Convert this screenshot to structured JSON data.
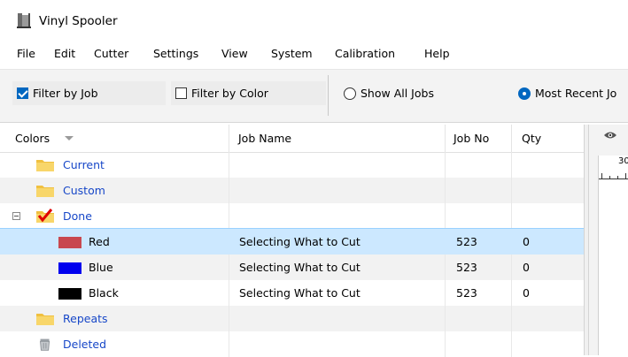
{
  "window": {
    "title": "Vinyl Spooler",
    "icon": "vinyl-spooler-app-icon"
  },
  "menu": [
    "File",
    "Edit",
    "Cutter",
    "Settings",
    "View",
    "System",
    "Calibration",
    "Help"
  ],
  "toolbar": {
    "filter_by_job": {
      "label": "Filter by Job",
      "checked": true
    },
    "filter_by_color": {
      "label": "Filter by Color",
      "checked": false
    },
    "show_all_jobs": {
      "label": "Show All Jobs",
      "selected": false
    },
    "most_recent_jobs": {
      "label": "Most Recent Jo",
      "selected": true
    }
  },
  "columns": {
    "colors": "Colors",
    "job_name": "Job Name",
    "job_no": "Job No",
    "qty": "Qty"
  },
  "rows": [
    {
      "kind": "folder",
      "label": "Current",
      "icon": "folder-icon"
    },
    {
      "kind": "folder",
      "label": "Custom",
      "icon": "folder-icon"
    },
    {
      "kind": "folder",
      "label": "Done",
      "icon": "done-folder-check-icon",
      "expanded": true
    },
    {
      "kind": "item",
      "label": "Red",
      "swatch": "#c8484f",
      "job_name": "Selecting What to Cut",
      "job_no": "523",
      "qty": "0",
      "selected": true
    },
    {
      "kind": "item",
      "label": "Blue",
      "swatch": "#0000ee",
      "job_name": "Selecting What to Cut",
      "job_no": "523",
      "qty": "0"
    },
    {
      "kind": "item",
      "label": "Black",
      "swatch": "#000000",
      "job_name": "Selecting What to Cut",
      "job_no": "523",
      "qty": "0"
    },
    {
      "kind": "folder",
      "label": "Repeats",
      "icon": "folder-icon"
    },
    {
      "kind": "folder",
      "label": "Deleted",
      "icon": "trash-icon"
    }
  ],
  "preview": {
    "ruler_label": "30",
    "eye_icon": "eye-icon"
  },
  "colors": {
    "accent": "#0067c0",
    "folder_label": "#1747c8",
    "selection": "#cce8ff"
  }
}
